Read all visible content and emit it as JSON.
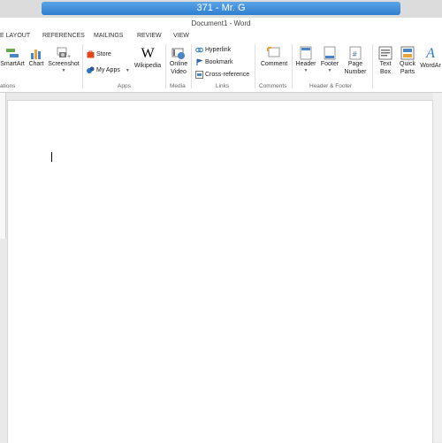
{
  "window": {
    "outer_title": "371 - Mr. G",
    "doc_title": "Document1 - Word"
  },
  "tabs": [
    "E LAYOUT",
    "REFERENCES",
    "MAILINGS",
    "REVIEW",
    "VIEW"
  ],
  "ribbon": {
    "illustrations": {
      "group": "ations",
      "smartart": "SmartArt",
      "chart": "Chart",
      "screenshot": "Screenshot"
    },
    "apps": {
      "group": "Apps",
      "store": "Store",
      "my_apps": "My Apps",
      "wikipedia": "Wikipedia"
    },
    "media": {
      "group": "Media",
      "online_video_1": "Online",
      "online_video_2": "Video"
    },
    "links": {
      "group": "Links",
      "hyperlink": "Hyperlink",
      "bookmark": "Bookmark",
      "cross_reference": "Cross-reference"
    },
    "comments": {
      "group": "Comments",
      "comment": "Comment"
    },
    "header_footer": {
      "group": "Header & Footer",
      "header": "Header",
      "footer": "Footer",
      "page_number_1": "Page",
      "page_number_2": "Number"
    },
    "text": {
      "text_box_1": "Text",
      "text_box_2": "Box",
      "quick_parts_1": "Quick",
      "quick_parts_2": "Parts",
      "wordart": "WordAr"
    }
  },
  "colors": {
    "title_bar": "#2f7fd1",
    "accent": "#2b579a",
    "store": "#e0481f",
    "wikipedia": "#000000"
  }
}
